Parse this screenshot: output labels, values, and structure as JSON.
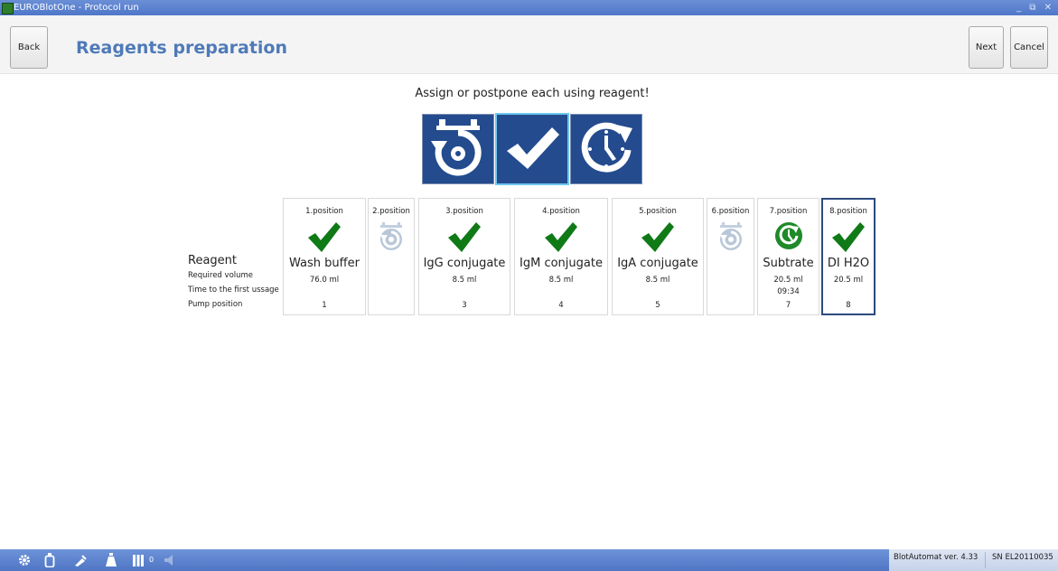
{
  "window": {
    "title": "EUROBlotOne - Protocol run",
    "controls": "_ ⧉ ✕"
  },
  "header": {
    "back_label": "Back",
    "title": "Reagents preparation",
    "next_label": "Next",
    "cancel_label": "Cancel"
  },
  "main": {
    "instruction": "Assign or postpone each using reagent!",
    "action_buttons": [
      {
        "icon": "unassign-icon",
        "selected": false
      },
      {
        "icon": "checkmark-icon",
        "selected": true
      },
      {
        "icon": "postpone-clock-icon",
        "selected": false
      }
    ],
    "row_labels": {
      "reagent": "Reagent",
      "required_volume": "Required volume",
      "time_to_first_usage": "Time to the first ussage",
      "pump_position": "Pump position"
    },
    "positions": [
      {
        "label": "1.position",
        "status": "assigned",
        "icon": "checkmark-icon",
        "name": "Wash buffer",
        "volume": "76.0 ml",
        "time": "",
        "pump": "1"
      },
      {
        "label": "2.position",
        "status": "empty",
        "icon": "unassign-icon",
        "name": "",
        "volume": "",
        "time": "",
        "pump": ""
      },
      {
        "label": "3.position",
        "status": "assigned",
        "icon": "checkmark-icon",
        "name": "IgG conjugate",
        "volume": "8.5 ml",
        "time": "",
        "pump": "3"
      },
      {
        "label": "4.position",
        "status": "assigned",
        "icon": "checkmark-icon",
        "name": "IgM conjugate",
        "volume": "8.5 ml",
        "time": "",
        "pump": "4"
      },
      {
        "label": "5.position",
        "status": "assigned",
        "icon": "checkmark-icon",
        "name": "IgA conjugate",
        "volume": "8.5 ml",
        "time": "",
        "pump": "5"
      },
      {
        "label": "6.position",
        "status": "empty",
        "icon": "unassign-icon",
        "name": "",
        "volume": "",
        "time": "",
        "pump": ""
      },
      {
        "label": "7.position",
        "status": "postponed",
        "icon": "postpone-clock-icon",
        "name": "Subtrate",
        "volume": "20.5 ml",
        "time": "09:34",
        "pump": "7"
      },
      {
        "label": "8.position",
        "status": "assigned",
        "icon": "checkmark-icon",
        "name": "DI H2O",
        "volume": "20.5 ml",
        "time": "",
        "pump": "8",
        "selected": true
      }
    ]
  },
  "statusbar": {
    "icons": [
      "gear-icon",
      "bottle-icon",
      "pipette-icon",
      "flask-icon",
      "strips-icon",
      "speaker-muted-icon"
    ],
    "strips_count": "0",
    "version": "BlotAutomat ver. 4.33",
    "serial": "SN EL20110035"
  },
  "colors": {
    "accent": "#4f7ab8",
    "button_blue": "#234b8e",
    "check_green": "#0f7a16",
    "clock_green": "#1e8a28",
    "disabled_gray": "#b9c7d8",
    "statusbar": "#5b82ce"
  }
}
